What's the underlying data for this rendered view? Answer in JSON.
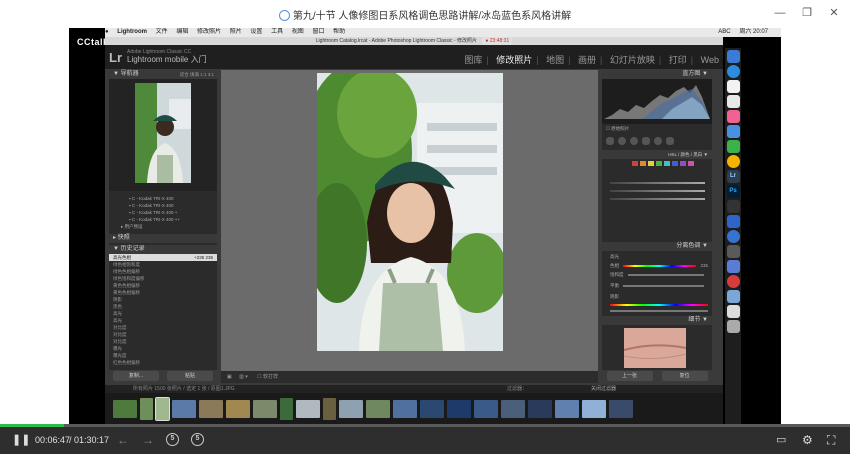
{
  "window": {
    "title": "第九/十节 人像修图日系风格调色思路讲解/冰岛蓝色系风格讲解"
  },
  "watermark": "CCtalk",
  "mac_menu": {
    "items": [
      "Lightroom",
      "文件",
      "编辑",
      "修改照片",
      "照片",
      "设置",
      "工具",
      "视图",
      "窗口",
      "帮助"
    ],
    "status": {
      "input": "ABC",
      "clock": "周六 20:07"
    }
  },
  "lightroom": {
    "window_title": "Lightroom Catalog.lrcat - Adobe Photoshop Lightroom Classic - 修改照片",
    "recording_time": "23:48:31",
    "app_name": "Adobe Lightroom Classic CC",
    "app_sub": "Lightroom mobile 入门",
    "modules": [
      "图库",
      "修改照片",
      "地图",
      "画册",
      "幻灯片放映",
      "打印",
      "Web"
    ],
    "left": {
      "navigator": "导航器",
      "navigator_opts": "适合 填满 1:1 3:1",
      "presets": [
        "C - Kodak TRI-X 400",
        "C - Kodak TRI-X 400",
        "C - Kodak TRI-X 400 +",
        "C - Kodak TRI-X 400 ++"
      ],
      "user_presets": "用户预设",
      "snapshots": "快照",
      "history": "历史记录",
      "history_items": [
        {
          "name": "高光色相",
          "a": "+235",
          "b": "235"
        },
        {
          "name": "绿色相饱和度",
          "a": "",
          "b": ""
        },
        {
          "name": "绿色色相偏移",
          "a": "",
          "b": ""
        },
        {
          "name": "绿色饱和度偏移",
          "a": "",
          "b": ""
        },
        {
          "name": "黄色色相偏移",
          "a": "",
          "b": ""
        },
        {
          "name": "黄色色相偏移",
          "a": "",
          "b": ""
        },
        {
          "name": "阴影",
          "a": "",
          "b": ""
        },
        {
          "name": "黑色",
          "a": "",
          "b": ""
        },
        {
          "name": "高光",
          "a": "",
          "b": ""
        },
        {
          "name": "高光",
          "a": "",
          "b": ""
        },
        {
          "name": "对比度",
          "a": "",
          "b": ""
        },
        {
          "name": "对比度",
          "a": "",
          "b": ""
        },
        {
          "name": "对比度",
          "a": "",
          "b": ""
        },
        {
          "name": "曝光",
          "a": "",
          "b": ""
        },
        {
          "name": "曝光度",
          "a": "",
          "b": ""
        },
        {
          "name": "红色色相偏移",
          "a": "",
          "b": ""
        }
      ],
      "copy_btn": "复制...",
      "paste_btn": "粘贴"
    },
    "toolbar": {
      "softproof": "软打样"
    },
    "right": {
      "histogram": "直方图",
      "original_photo": "原始照片",
      "hsl": "HSL / 颜色 / 黑白",
      "split_toning": "分离色调",
      "highlights": "高光",
      "hue": "色相",
      "saturation": "饱和度",
      "balance": "平衡",
      "shadows": "阴影",
      "hue_value": "235",
      "detail": "细节",
      "prev_btn": "上一张",
      "reset_btn": "复位"
    },
    "filmstrip": {
      "source": "所有照片 1500 张照片 / 选定 1 张 / 原图1.JPG",
      "filter": "过滤器：",
      "filter_value": "关闭过滤器"
    }
  },
  "player": {
    "current_time": "00:06:47",
    "separator": "/",
    "duration": "01:30:17",
    "progress": 0.075,
    "skip_back": "5",
    "skip_forward": "5"
  }
}
